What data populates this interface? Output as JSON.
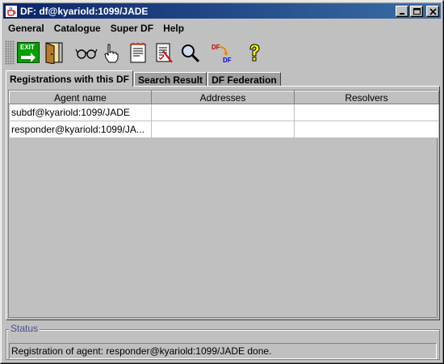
{
  "window": {
    "title": "DF:  df@kyariold:1099/JADE"
  },
  "menu": [
    "General",
    "Catalogue",
    "Super DF",
    "Help"
  ],
  "toolbar": {
    "buttons": [
      "exit-icon",
      "door-icon",
      "glasses-icon",
      "pointing-hand-icon",
      "register-icon",
      "deregister-icon",
      "search-icon",
      "df-federate-icon",
      "help-icon"
    ],
    "exit_label": "EXIT",
    "df_top": "DF",
    "df_bottom": "DF"
  },
  "tabs": [
    {
      "label": "Registrations with this DF",
      "active": true
    },
    {
      "label": "Search Result",
      "active": false
    },
    {
      "label": "DF Federation",
      "active": false
    }
  ],
  "table": {
    "columns": [
      "Agent name",
      "Addresses",
      "Resolvers"
    ],
    "rows": [
      [
        "subdf@kyariold:1099/JADE",
        "",
        ""
      ],
      [
        "responder@kyariold:1099/JA...",
        "",
        ""
      ]
    ]
  },
  "status": {
    "label": "Status",
    "text": "Registration of agent: responder@kyariold:1099/JADE done."
  },
  "colors": {
    "title_start": "#0a246a",
    "title_end": "#3a6ea5",
    "status_legend": "#4a4e8e"
  }
}
